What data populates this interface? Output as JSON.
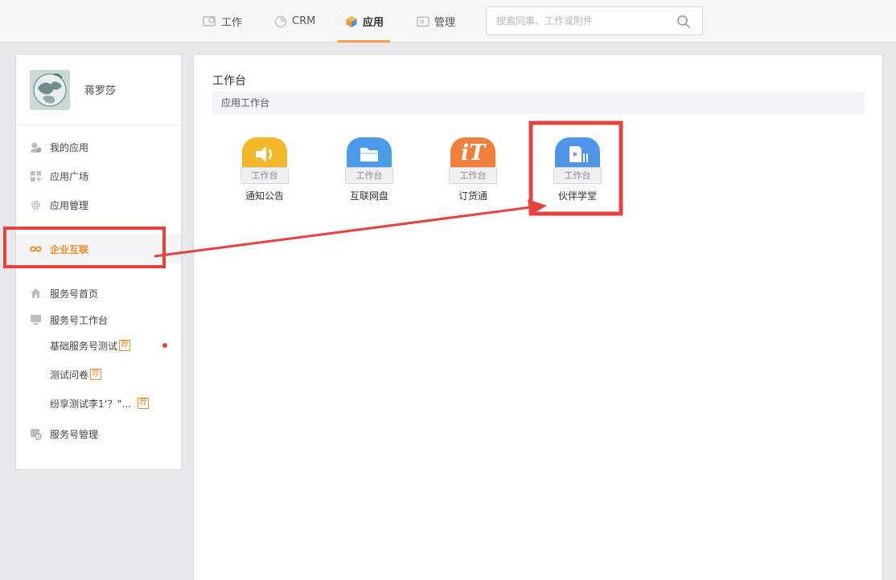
{
  "nav": {
    "tabs": [
      {
        "label": "工作",
        "icon": "work-icon"
      },
      {
        "label": "CRM",
        "icon": "crm-icon"
      },
      {
        "label": "应用",
        "icon": "app-cube-icon",
        "active": true
      },
      {
        "label": "管理",
        "icon": "manage-icon"
      }
    ],
    "search_placeholder": "搜索同事、工作或附件"
  },
  "user": {
    "name": "蒋罗莎"
  },
  "sidebar": {
    "items": [
      {
        "label": "我的应用",
        "icon": "my-apps-icon"
      },
      {
        "label": "应用广场",
        "icon": "app-square-icon"
      },
      {
        "label": "应用管理",
        "icon": "gear-icon"
      },
      {
        "label": "企业互联",
        "icon": "infinity-icon",
        "active": true
      },
      {
        "label": "服务号首页",
        "icon": "home-icon"
      },
      {
        "label": "服务号工作台",
        "icon": "monitor-icon"
      },
      {
        "label": "服务号管理",
        "icon": "service-manage-icon"
      }
    ],
    "sub_items": [
      {
        "label": "基础服务号测试",
        "badge": "荐",
        "unread": true
      },
      {
        "label": "测试问卷",
        "badge": "荐"
      },
      {
        "label": "纷享测试李1‘？”...",
        "badge": "荐"
      }
    ]
  },
  "main": {
    "title": "工作台",
    "section_label": "应用工作台",
    "apps": [
      {
        "name": "通知公告",
        "tag": "工作台",
        "color": "#f5b829",
        "icon": "speaker-icon"
      },
      {
        "name": "互联网盘",
        "tag": "工作台",
        "color": "#4a9bea",
        "icon": "folder-icon"
      },
      {
        "name": "订货通",
        "tag": "工作台",
        "color": "#f07f3c",
        "icon": "it-logo-icon",
        "glyph": "iT"
      },
      {
        "name": "伙伴学堂",
        "tag": "工作台",
        "color": "#4f95e8",
        "icon": "video-play-icon"
      }
    ]
  },
  "colors": {
    "accent": "#f5a04a",
    "active_text": "#f08a2c",
    "annotation": "#e8423f"
  }
}
